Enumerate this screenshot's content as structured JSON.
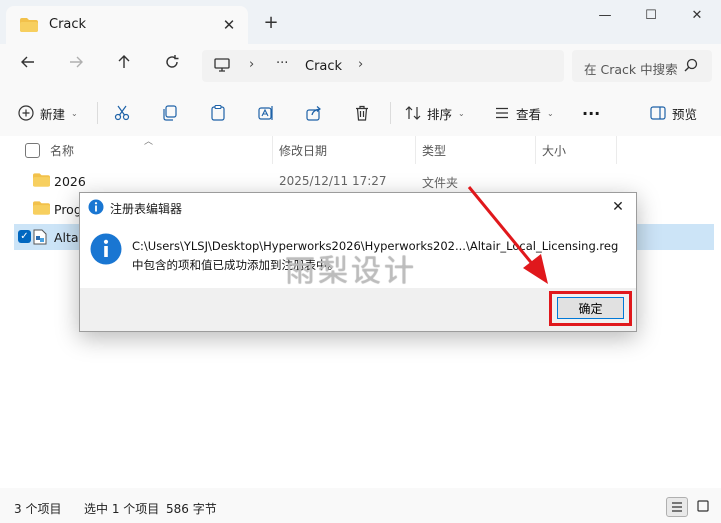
{
  "tab": {
    "title": "Crack",
    "new_tab": "+"
  },
  "window": {
    "minimize": "—",
    "maximize": "☐",
    "close": "✕"
  },
  "address": {
    "more": "···",
    "crumb": "Crack"
  },
  "search": {
    "placeholder": "在 Crack 中搜索"
  },
  "toolbar": {
    "new_label": "新建",
    "sort_label": "排序",
    "view_label": "查看",
    "more": "···",
    "preview_label": "预览"
  },
  "columns": {
    "name": "名称",
    "date": "修改日期",
    "type": "类型",
    "size": "大小"
  },
  "files": [
    {
      "name": "2026",
      "date": "2025/12/11 17:27",
      "type": "文件夹"
    },
    {
      "name": "Prog",
      "date": "",
      "type": ""
    },
    {
      "name": "Altai",
      "date": "",
      "type": ""
    }
  ],
  "status": {
    "count": "3 个项目",
    "selected": "选中 1 个项目",
    "size": "586 字节"
  },
  "dialog": {
    "title": "注册表编辑器",
    "line1": "C:\\Users\\YLSJ\\Desktop\\Hyperworks2026\\Hyperworks202...\\Altair_Local_Licensing.reg",
    "line2": "中包含的项和值已成功添加到注册表中。",
    "ok": "确定"
  },
  "watermark": "雨梨设计",
  "colors": {
    "accent": "#0067c0",
    "folder": "#f2c14b",
    "highlight": "#e0181c",
    "info": "#1976d2"
  }
}
